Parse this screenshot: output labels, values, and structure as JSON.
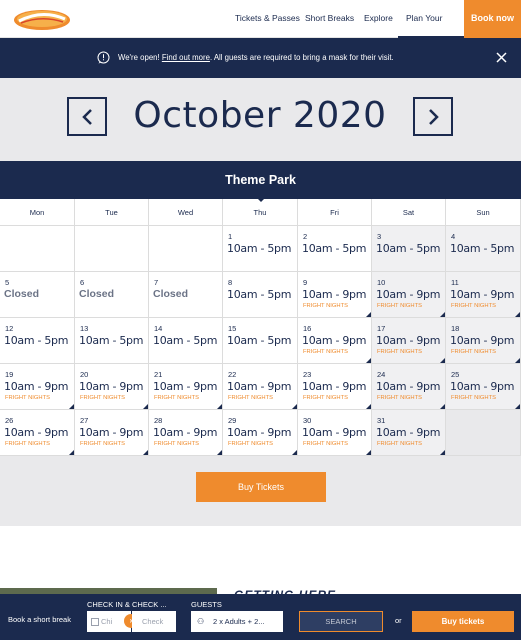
{
  "header": {
    "nav": [
      {
        "label": "Tickets & Passes"
      },
      {
        "label": "Short Breaks"
      },
      {
        "label": "Explore"
      },
      {
        "label": "Plan Your Visit",
        "active": true
      }
    ],
    "book_now": "Book now",
    "colors": {
      "brand_navy": "#1b2a4e",
      "accent_orange": "#ef8b2d"
    }
  },
  "notice": {
    "text_before": "We're open! ",
    "link": "Find out more",
    "text_after": ". All guests are required to bring a mask for their visit."
  },
  "calendar": {
    "month": "October 2020",
    "section_title": "Theme Park",
    "days_of_week": [
      "Mon",
      "Tue",
      "Wed",
      "Thu",
      "Fri",
      "Sat",
      "Sun"
    ],
    "weeks": [
      [
        null,
        null,
        null,
        {
          "day": "1",
          "hours": "10am - 5pm",
          "tag": ""
        },
        {
          "day": "2",
          "hours": "10am - 5pm",
          "tag": ""
        },
        {
          "day": "3",
          "hours": "10am - 5pm",
          "tag": ""
        },
        {
          "day": "4",
          "hours": "10am - 5pm",
          "tag": ""
        }
      ],
      [
        {
          "day": "5",
          "hours": "Closed",
          "tag": ""
        },
        {
          "day": "6",
          "hours": "Closed",
          "tag": ""
        },
        {
          "day": "7",
          "hours": "Closed",
          "tag": ""
        },
        {
          "day": "8",
          "hours": "10am - 5pm",
          "tag": ""
        },
        {
          "day": "9",
          "hours": "10am - 9pm",
          "tag": "FRIGHT NIGHTS"
        },
        {
          "day": "10",
          "hours": "10am - 9pm",
          "tag": "FRIGHT NIGHTS"
        },
        {
          "day": "11",
          "hours": "10am - 9pm",
          "tag": "FRIGHT NIGHTS"
        }
      ],
      [
        {
          "day": "12",
          "hours": "10am - 5pm",
          "tag": ""
        },
        {
          "day": "13",
          "hours": "10am - 5pm",
          "tag": ""
        },
        {
          "day": "14",
          "hours": "10am - 5pm",
          "tag": ""
        },
        {
          "day": "15",
          "hours": "10am - 5pm",
          "tag": ""
        },
        {
          "day": "16",
          "hours": "10am - 9pm",
          "tag": "FRIGHT NIGHTS"
        },
        {
          "day": "17",
          "hours": "10am - 9pm",
          "tag": "FRIGHT NIGHTS"
        },
        {
          "day": "18",
          "hours": "10am - 9pm",
          "tag": "FRIGHT NIGHTS"
        }
      ],
      [
        {
          "day": "19",
          "hours": "10am - 9pm",
          "tag": "FRIGHT NIGHTS"
        },
        {
          "day": "20",
          "hours": "10am - 9pm",
          "tag": "FRIGHT NIGHTS"
        },
        {
          "day": "21",
          "hours": "10am - 9pm",
          "tag": "FRIGHT NIGHTS"
        },
        {
          "day": "22",
          "hours": "10am - 9pm",
          "tag": "FRIGHT NIGHTS"
        },
        {
          "day": "23",
          "hours": "10am - 9pm",
          "tag": "FRIGHT NIGHTS"
        },
        {
          "day": "24",
          "hours": "10am - 9pm",
          "tag": "FRIGHT NIGHTS"
        },
        {
          "day": "25",
          "hours": "10am - 9pm",
          "tag": "FRIGHT NIGHTS"
        }
      ],
      [
        {
          "day": "26",
          "hours": "10am - 9pm",
          "tag": "FRIGHT NIGHTS"
        },
        {
          "day": "27",
          "hours": "10am - 9pm",
          "tag": "FRIGHT NIGHTS"
        },
        {
          "day": "28",
          "hours": "10am - 9pm",
          "tag": "FRIGHT NIGHTS"
        },
        {
          "day": "29",
          "hours": "10am - 9pm",
          "tag": "FRIGHT NIGHTS"
        },
        {
          "day": "30",
          "hours": "10am - 9pm",
          "tag": "FRIGHT NIGHTS"
        },
        {
          "day": "31",
          "hours": "10am - 9pm",
          "tag": "FRIGHT NIGHTS"
        },
        null
      ]
    ],
    "buy_tickets": "Buy Tickets"
  },
  "below": {
    "heading": "GETTING HERE"
  },
  "booking_bar": {
    "label": "Book a short break",
    "dates_label": "CHECK IN & CHECK ...",
    "check_in_placeholder": "Chi",
    "check_out_placeholder": "Check",
    "guests_label": "GUESTS",
    "guests_value": "2 x Adults + 2...",
    "search": "SEARCH",
    "or": "or",
    "buy_tickets": "Buy tickets"
  }
}
